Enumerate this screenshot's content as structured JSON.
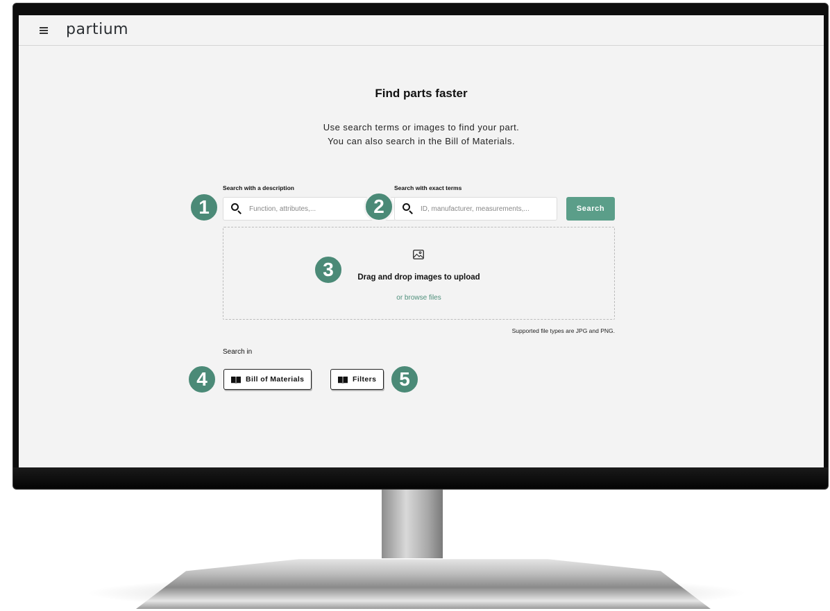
{
  "header": {
    "brand": "partium"
  },
  "main": {
    "title": "Find parts faster",
    "subtitle_line1": "Use search terms or images to find your part.",
    "subtitle_line2": "You can also search in the Bill of Materials.",
    "description_search": {
      "label": "Search with a description",
      "placeholder": "Function, attributes,..."
    },
    "exact_search": {
      "label": "Search with exact terms",
      "placeholder": "ID, manufacturer, measurements,..."
    },
    "search_button": "Search",
    "dropzone": {
      "title": "Drag and drop images to upload",
      "link": "or browse files",
      "icon": "image-icon"
    },
    "file_types_note": "Supported file types are JPG and PNG.",
    "search_in": {
      "label": "Search in",
      "options": [
        {
          "label": "Bill of Materials",
          "icon": "book-icon"
        },
        {
          "label": "Filters",
          "icon": "book-icon"
        }
      ]
    }
  },
  "callouts": [
    "1",
    "2",
    "3",
    "4",
    "5"
  ],
  "colors": {
    "accent": "#5b9e89",
    "callout": "#4b8a77",
    "background": "#f3f3f3"
  }
}
